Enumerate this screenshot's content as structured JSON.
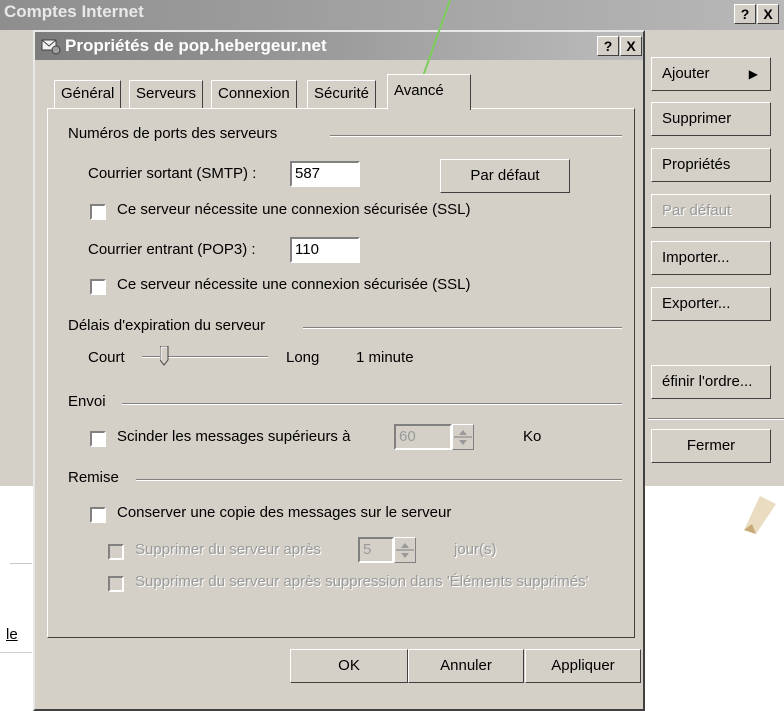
{
  "back_window": {
    "title": "Comptes Internet",
    "help_btn": "?",
    "close_btn": "X",
    "buttons": {
      "add": "Ajouter",
      "remove": "Supprimer",
      "properties": "Propriétés",
      "default": "Par défaut",
      "import": "Importer...",
      "export": "Exporter...",
      "order": "éfinir l'ordre...",
      "close": "Fermer"
    },
    "left_fragment": "le"
  },
  "dialog": {
    "title": "Propriétés de pop.hebergeur.net",
    "help_btn": "?",
    "close_btn": "X",
    "tabs": [
      "Général",
      "Serveurs",
      "Connexion",
      "Sécurité",
      "Avancé"
    ],
    "active_tab": "Avancé",
    "ports": {
      "heading": "Numéros de ports des serveurs",
      "smtp_label": "Courrier sortant (SMTP) :",
      "smtp_value": "587",
      "default_btn": "Par défaut",
      "ssl_smtp_label": "Ce serveur nécessite une connexion sécurisée (SSL)",
      "pop3_label": "Courrier entrant (POP3) :",
      "pop3_value": "110",
      "ssl_pop3_label": "Ce serveur nécessite une connexion sécurisée (SSL)"
    },
    "timeout": {
      "heading": "Délais d'expiration du serveur",
      "short": "Court",
      "long": "Long",
      "value": "1 minute",
      "slider_level": 0.15
    },
    "send": {
      "heading": "Envoi",
      "split_label": "Scinder les messages supérieurs à",
      "split_value": "60",
      "unit": "Ko"
    },
    "delivery": {
      "heading": "Remise",
      "keep_copy_label": "Conserver une copie des messages sur le serveur",
      "delete_after_label": "Supprimer du serveur après",
      "delete_after_value": "5",
      "days_unit": "jour(s)",
      "delete_on_trash_label": "Supprimer du serveur après suppression dans 'Éléments supprimés'"
    },
    "footer": {
      "ok": "OK",
      "cancel": "Annuler",
      "apply": "Appliquer"
    }
  },
  "colors": {
    "dialog_bg": "#d4d0c8",
    "annotation_arrow": "#7ccf5a"
  }
}
